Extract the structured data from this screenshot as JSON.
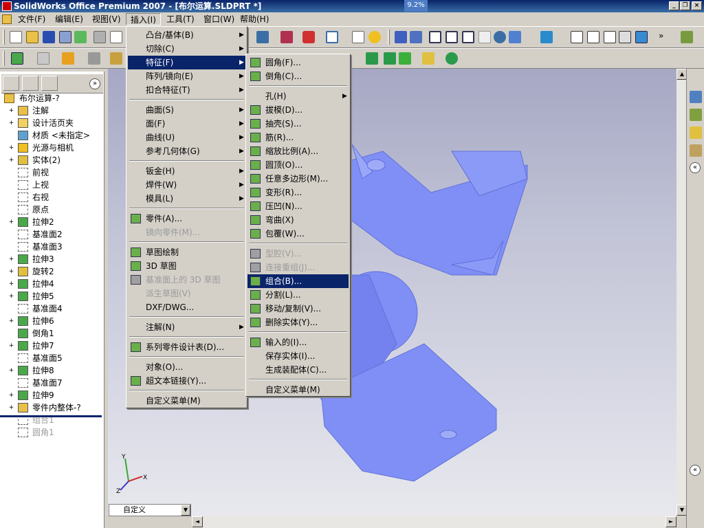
{
  "window": {
    "title": "SolidWorks Office Premium 2007 - [布尔运算.SLDPRT *]",
    "overlay_percent": "9.2%"
  },
  "menubar": {
    "items": [
      {
        "label": "文件(F)"
      },
      {
        "label": "编辑(E)"
      },
      {
        "label": "视图(V)"
      },
      {
        "label": "插入(I)"
      },
      {
        "label": "工具(T)"
      },
      {
        "label": "窗口(W)"
      },
      {
        "label": "帮助(H)"
      }
    ]
  },
  "feature_tree": {
    "root": "布尔运算-?",
    "items": [
      {
        "label": "注解",
        "icon": "annotation-icon",
        "expandable": true
      },
      {
        "label": "设计活页夹",
        "icon": "binder-icon",
        "expandable": true
      },
      {
        "label": "材质 <未指定>",
        "icon": "material-icon",
        "expandable": false
      },
      {
        "label": "光源与相机",
        "icon": "lights-icon",
        "expandable": true
      },
      {
        "label": "实体(2)",
        "icon": "solid-bodies-icon",
        "expandable": true
      },
      {
        "label": "前视",
        "icon": "plane-icon",
        "expandable": false
      },
      {
        "label": "上视",
        "icon": "plane-icon",
        "expandable": false
      },
      {
        "label": "右视",
        "icon": "plane-icon",
        "expandable": false
      },
      {
        "label": "原点",
        "icon": "origin-icon",
        "expandable": false
      },
      {
        "label": "拉伸2",
        "icon": "extrude-icon",
        "expandable": true
      },
      {
        "label": "基准面2",
        "icon": "plane-icon",
        "expandable": false
      },
      {
        "label": "基准面3",
        "icon": "plane-icon",
        "expandable": false
      },
      {
        "label": "拉伸3",
        "icon": "extrude-icon",
        "expandable": true
      },
      {
        "label": "旋转2",
        "icon": "revolve-icon",
        "expandable": true
      },
      {
        "label": "拉伸4",
        "icon": "extrude-icon",
        "expandable": true
      },
      {
        "label": "拉伸5",
        "icon": "extrude-icon",
        "expandable": true
      },
      {
        "label": "基准面4",
        "icon": "plane-icon",
        "expandable": false
      },
      {
        "label": "拉伸6",
        "icon": "extrude-icon",
        "expandable": true
      },
      {
        "label": "倒角1",
        "icon": "chamfer-icon",
        "expandable": false
      },
      {
        "label": "拉伸7",
        "icon": "extrude-icon",
        "expandable": true
      },
      {
        "label": "基准面5",
        "icon": "plane-icon",
        "expandable": false
      },
      {
        "label": "拉伸8",
        "icon": "extrude-icon",
        "expandable": true
      },
      {
        "label": "基准面7",
        "icon": "plane-icon",
        "expandable": false
      },
      {
        "label": "拉伸9",
        "icon": "extrude-icon",
        "expandable": true
      },
      {
        "label": "零件内整体-?",
        "icon": "part-icon",
        "expandable": true
      },
      {
        "label": "组合1",
        "icon": "combine-icon",
        "expandable": false,
        "grey": true
      },
      {
        "label": "圆角1",
        "icon": "fillet-icon",
        "expandable": false,
        "grey": true
      }
    ]
  },
  "insert_menu": {
    "items": [
      {
        "label": "凸台/基体(B)",
        "submenu": true
      },
      {
        "label": "切除(C)",
        "submenu": true
      },
      {
        "label": "特征(F)",
        "submenu": true,
        "highlighted": true
      },
      {
        "label": "阵列/镜向(E)",
        "submenu": true
      },
      {
        "label": "扣合特征(T)",
        "submenu": true
      },
      {
        "sep": true
      },
      {
        "label": "曲面(S)",
        "submenu": true
      },
      {
        "label": "面(F)",
        "submenu": true
      },
      {
        "label": "曲线(U)",
        "submenu": true
      },
      {
        "label": "参考几何体(G)",
        "submenu": true
      },
      {
        "sep": true
      },
      {
        "label": "钣金(H)",
        "submenu": true
      },
      {
        "label": "焊件(W)",
        "submenu": true
      },
      {
        "label": "模具(L)",
        "submenu": true
      },
      {
        "sep": true
      },
      {
        "label": "零件(A)...",
        "icon": "part-icon"
      },
      {
        "label": "镜向零件(M)...",
        "disabled": true
      },
      {
        "sep": true
      },
      {
        "label": "草图绘制",
        "icon": "sketch-icon"
      },
      {
        "label": "3D 草图",
        "icon": "sketch-3d-icon"
      },
      {
        "label": "基准面上的 3D 草图",
        "icon": "sketch-3d-plane-icon",
        "disabled": true
      },
      {
        "label": "派生草图(V)",
        "disabled": true
      },
      {
        "label": "DXF/DWG..."
      },
      {
        "sep": true
      },
      {
        "label": "注解(N)",
        "submenu": true
      },
      {
        "sep": true
      },
      {
        "label": "系列零件设计表(D)...",
        "icon": "design-table-icon"
      },
      {
        "sep": true
      },
      {
        "label": "对象(O)..."
      },
      {
        "label": "超文本链接(Y)...",
        "icon": "hyperlink-icon"
      },
      {
        "sep": true
      },
      {
        "label": "自定义菜单(M)"
      }
    ]
  },
  "features_submenu": {
    "items": [
      {
        "label": "圆角(F)...",
        "icon": "fillet-icon"
      },
      {
        "label": "倒角(C)...",
        "icon": "chamfer-icon"
      },
      {
        "sep": true
      },
      {
        "label": "孔(H)",
        "submenu": true
      },
      {
        "label": "拔模(D)...",
        "icon": "draft-icon"
      },
      {
        "label": "抽壳(S)...",
        "icon": "shell-icon"
      },
      {
        "label": "筋(R)...",
        "icon": "rib-icon"
      },
      {
        "label": "缩放比例(A)...",
        "icon": "scale-icon"
      },
      {
        "label": "圆顶(O)...",
        "icon": "dome-icon"
      },
      {
        "label": "任意多边形(M)...",
        "icon": "freeform-icon"
      },
      {
        "label": "变形(R)...",
        "icon": "deform-icon"
      },
      {
        "label": "压凹(N)...",
        "icon": "indent-icon"
      },
      {
        "label": "弯曲(X)",
        "icon": "flex-icon"
      },
      {
        "label": "包覆(W)...",
        "icon": "wrap-icon"
      },
      {
        "sep": true
      },
      {
        "label": "型腔(V)...",
        "icon": "cavity-icon",
        "disabled": true
      },
      {
        "label": "连接重组(J)...",
        "icon": "join-icon",
        "disabled": true
      },
      {
        "label": "组合(B)...",
        "icon": "combine-icon",
        "highlighted": true
      },
      {
        "label": "分割(L)...",
        "icon": "split-icon"
      },
      {
        "label": "移动/复制(V)...",
        "icon": "move-copy-icon"
      },
      {
        "label": "删除实体(Y)...",
        "icon": "delete-body-icon"
      },
      {
        "sep": true
      },
      {
        "label": "输入的(I)...",
        "icon": "imported-icon"
      },
      {
        "label": "保存实体(I)..."
      },
      {
        "label": "生成装配体(C)..."
      },
      {
        "sep": true
      },
      {
        "label": "自定义菜单(M)"
      }
    ]
  },
  "view_combo": {
    "value": "自定义"
  },
  "triad": {
    "x": "X",
    "y": "Y",
    "z": "Z"
  },
  "colors": {
    "model": "#7f8ff5",
    "selection": "#0a246a"
  }
}
